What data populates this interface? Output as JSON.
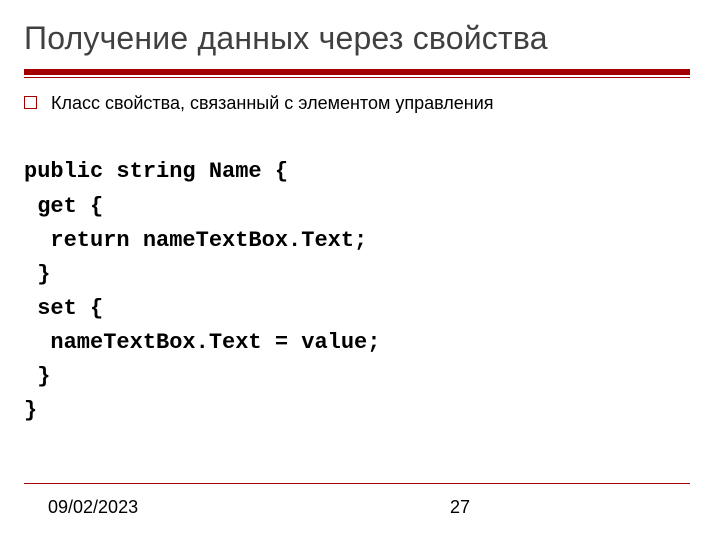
{
  "title": "Получение данных через свойства",
  "bullet": "Класс свойства, связанный с элементом управления",
  "code": {
    "l1": "public string Name {",
    "l2": " get {",
    "l3": "  return nameTextBox.Text;",
    "l4": " }",
    "l5": " set {",
    "l6": "  nameTextBox.Text = value;",
    "l7": " }",
    "l8": "}"
  },
  "footer": {
    "date": "09/02/2023",
    "page": "27"
  }
}
